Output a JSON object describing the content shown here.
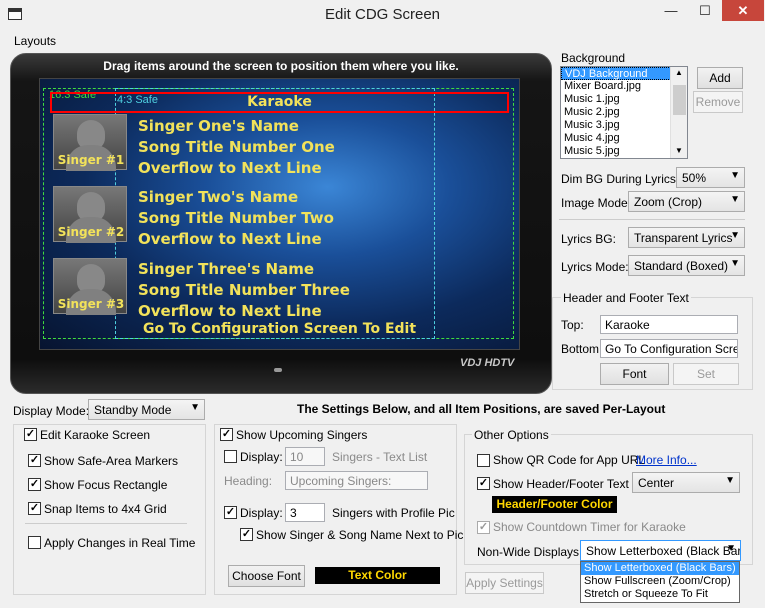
{
  "window": {
    "title": "Edit CDG Screen",
    "minimize": "—",
    "maximize": "☐",
    "close": "✕"
  },
  "menu": {
    "layouts": "Layouts"
  },
  "preview": {
    "hint": "Drag items around the screen to position them where you like.",
    "safe169": "16:3 Safe",
    "safe43": "4:3 Safe",
    "header": "Karaoke",
    "footer": "Go To Configuration Screen To Edit",
    "brand": "VDJ HDTV",
    "singers": [
      {
        "pic_label": "Singer #1",
        "name": "Singer One's Name",
        "song": "Song Title Number One",
        "overflow": "Overflow to Next Line"
      },
      {
        "pic_label": "Singer #2",
        "name": "Singer Two's Name",
        "song": "Song Title Number Two",
        "overflow": "Overflow to Next Line"
      },
      {
        "pic_label": "Singer #3",
        "name": "Singer Three's Name",
        "song": "Song Title Number Three",
        "overflow": "Overflow to Next Line"
      }
    ]
  },
  "background": {
    "label": "Background",
    "items": [
      "VDJ Background",
      "Mixer Board.jpg",
      "Music 1.jpg",
      "Music 2.jpg",
      "Music 3.jpg",
      "Music 4.jpg",
      "Music 5.jpg"
    ],
    "add": "Add",
    "remove": "Remove",
    "dim_label": "Dim BG During Lyrics:",
    "dim_value": "50%",
    "image_mode_label": "Image Mode:",
    "image_mode_value": "Zoom (Crop)",
    "lyrics_bg_label": "Lyrics BG:",
    "lyrics_bg_value": "Transparent Lyrics",
    "lyrics_mode_label": "Lyrics Mode:",
    "lyrics_mode_value": "Standard (Boxed)"
  },
  "header_footer": {
    "label": "Header and Footer Text",
    "top_label": "Top:",
    "top_value": "Karaoke",
    "bottom_label": "Bottom:",
    "bottom_value": "Go To Configuration Screen",
    "font": "Font",
    "set": "Set"
  },
  "display_mode": {
    "label": "Display Mode:",
    "value": "Standby Mode"
  },
  "notice": "The Settings Below, and all Item Positions, are saved Per-Layout",
  "left_group": {
    "edit": "Edit Karaoke Screen",
    "safe": "Show Safe-Area Markers",
    "focus": "Show Focus Rectangle",
    "snap": "Snap Items to 4x4 Grid",
    "apply_rt": "Apply Changes in Real Time"
  },
  "upcoming": {
    "show": "Show Upcoming Singers",
    "display": "Display:",
    "text_count": "10",
    "text_list": "Singers - Text List",
    "heading_label": "Heading:",
    "heading_value": "Upcoming Singers:",
    "display2": "Display:",
    "pic_count": "3",
    "pic_list": "Singers with Profile Pic",
    "show_name": "Show Singer & Song Name Next to Pic",
    "choose_font": "Choose Font",
    "text_color": "Text Color"
  },
  "other": {
    "label": "Other Options",
    "qr": "Show QR Code for App URL",
    "more_info": "More Info...",
    "show_hf": "Show Header/Footer Text",
    "hf_align": "Center",
    "hf_color": "Header/Footer Color",
    "countdown": "Show Countdown Timer for Karaoke",
    "nonwide_label": "Non-Wide Displays:",
    "nonwide_value": "Show Letterboxed (Black Bars)",
    "apply": "Apply Settings",
    "options": [
      "Show Letterboxed (Black Bars)",
      "Show Fullscreen (Zoom/Crop)",
      "Stretch or Squeeze To Fit"
    ]
  },
  "colors": {
    "accent": "#3399ff",
    "lyrics": "#f2e25a",
    "header_box": "#ff0000",
    "safe169": "#3fdc3f",
    "safe43": "#4fd0e0"
  }
}
